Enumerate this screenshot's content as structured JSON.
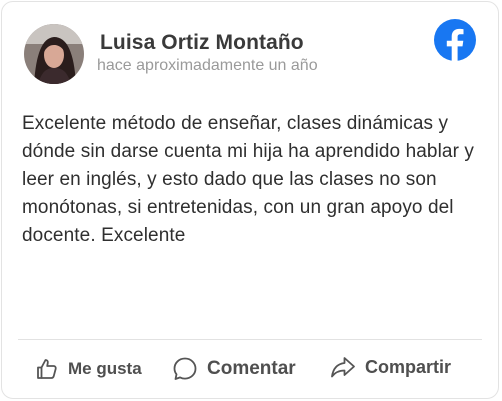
{
  "review": {
    "author_name": "Luisa Ortiz Montaño",
    "timestamp": "hace aproximadamente un año",
    "text": "Excelente método de enseñar, clases dinámicas y dónde sin darse cuenta mi hija ha aprendido hablar y leer en inglés, y esto dado que las clases no son monótonas, si entretenidas, con un gran apoyo del docente. Excelente",
    "source_icon": "facebook-icon",
    "brand_color": "#1877f2"
  },
  "actions": {
    "like_label": "Me gusta",
    "comment_label": "Comentar",
    "share_label": "Compartir",
    "like_icon": "thumbs-up-icon",
    "comment_icon": "speech-bubble-icon",
    "share_icon": "share-arrow-icon"
  }
}
